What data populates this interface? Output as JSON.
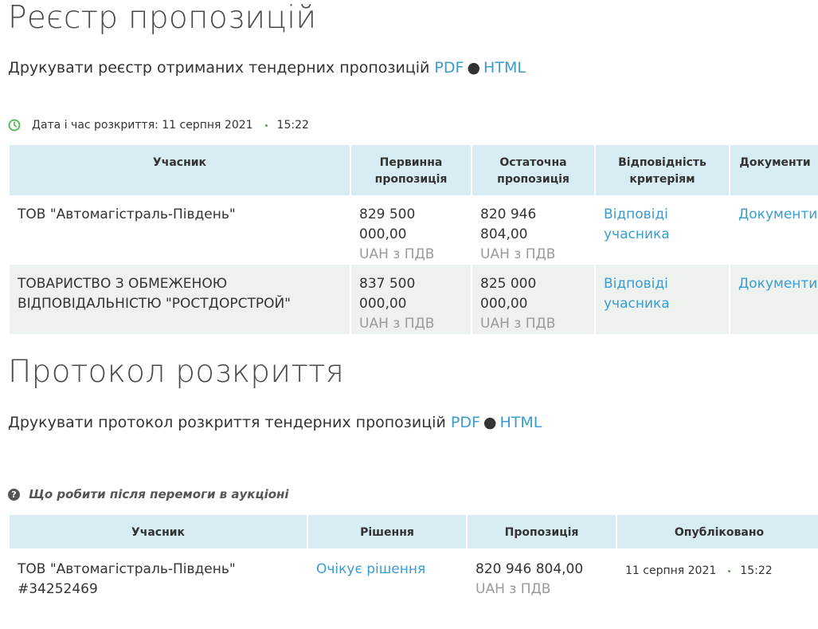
{
  "registry": {
    "title": "Реєстр пропозицій",
    "print_text": "Друкувати реєстр отриманих тендерних пропозицій",
    "pdf_label": "PDF",
    "html_label": "HTML",
    "separator": "●",
    "opening_label": "Дата і час розкриття: 11 серпня 2021",
    "opening_time": "15:22",
    "columns": [
      "Учасник",
      "Первинна пропозиція",
      "Остаточна пропозиція",
      "Відповідність критеріям",
      "Документи"
    ],
    "rows": [
      {
        "participant": "ТОВ \"Автомагістраль-Південь\"",
        "initial": "829 500 000,00",
        "initial_unit": "UAH з ПДВ",
        "final": "820 946 804,00",
        "final_unit": "UAH з ПДВ",
        "criteria_link": "Відповіді учасника",
        "docs_link": "Документи"
      },
      {
        "participant": "ТОВАРИСТВО З ОБМЕЖЕНОЮ ВІДПОВІДАЛЬНІСТЮ \"РОСТДОРСТРОЙ\"",
        "initial": "837 500 000,00",
        "initial_unit": "UAH з ПДВ",
        "final": "825 000 000,00",
        "final_unit": "UAH з ПДВ",
        "criteria_link": "Відповіді учасника",
        "docs_link": "Документи"
      }
    ]
  },
  "protocol": {
    "title": "Протокол розкриття",
    "print_text": "Друкувати протокол розкриття тендерних пропозицій",
    "pdf_label": "PDF",
    "html_label": "HTML",
    "separator": "●",
    "help_text": "Що робити після перемоги в аукціоні",
    "columns": [
      "Учасник",
      "Рішення",
      "Пропозиція",
      "Опубліковано"
    ],
    "rows": [
      {
        "participant": "ТОВ \"Автомагістраль-Південь\"",
        "participant_id": "#34252469",
        "decision_link": "Очікує рішення",
        "offer": "820 946 804,00",
        "offer_unit": "UAH з ПДВ",
        "published_date": "11 серпня 2021",
        "published_time": "15:22"
      }
    ]
  },
  "colors": {
    "link": "#3a9ccf",
    "header_bg": "#d8ecf3",
    "row_alt_bg": "#eef2ef",
    "clock_green": "#5cb85c"
  }
}
